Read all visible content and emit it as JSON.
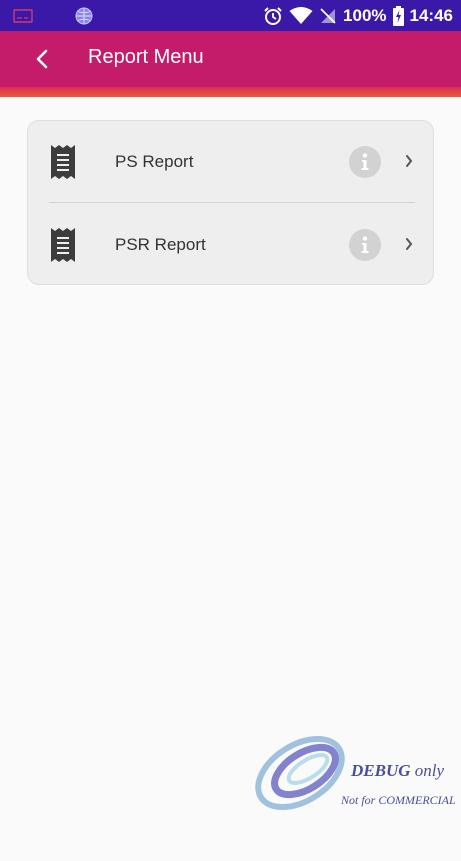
{
  "status_bar": {
    "battery": "100%",
    "time": "14:46"
  },
  "app_bar": {
    "title": "Report Menu"
  },
  "menu": {
    "items": [
      {
        "label": "PS Report",
        "icon": "receipt-icon"
      },
      {
        "label": "PSR Report",
        "icon": "receipt-icon"
      }
    ]
  },
  "watermark": {
    "debug": "DEBUG",
    "only": "only",
    "sub": "Not for COMMERCIAL"
  },
  "colors": {
    "status_bar": "#3a18a8",
    "app_bar": "#c41c6a",
    "card": "#eeeeee",
    "info_badge": "#d2d2d2"
  }
}
